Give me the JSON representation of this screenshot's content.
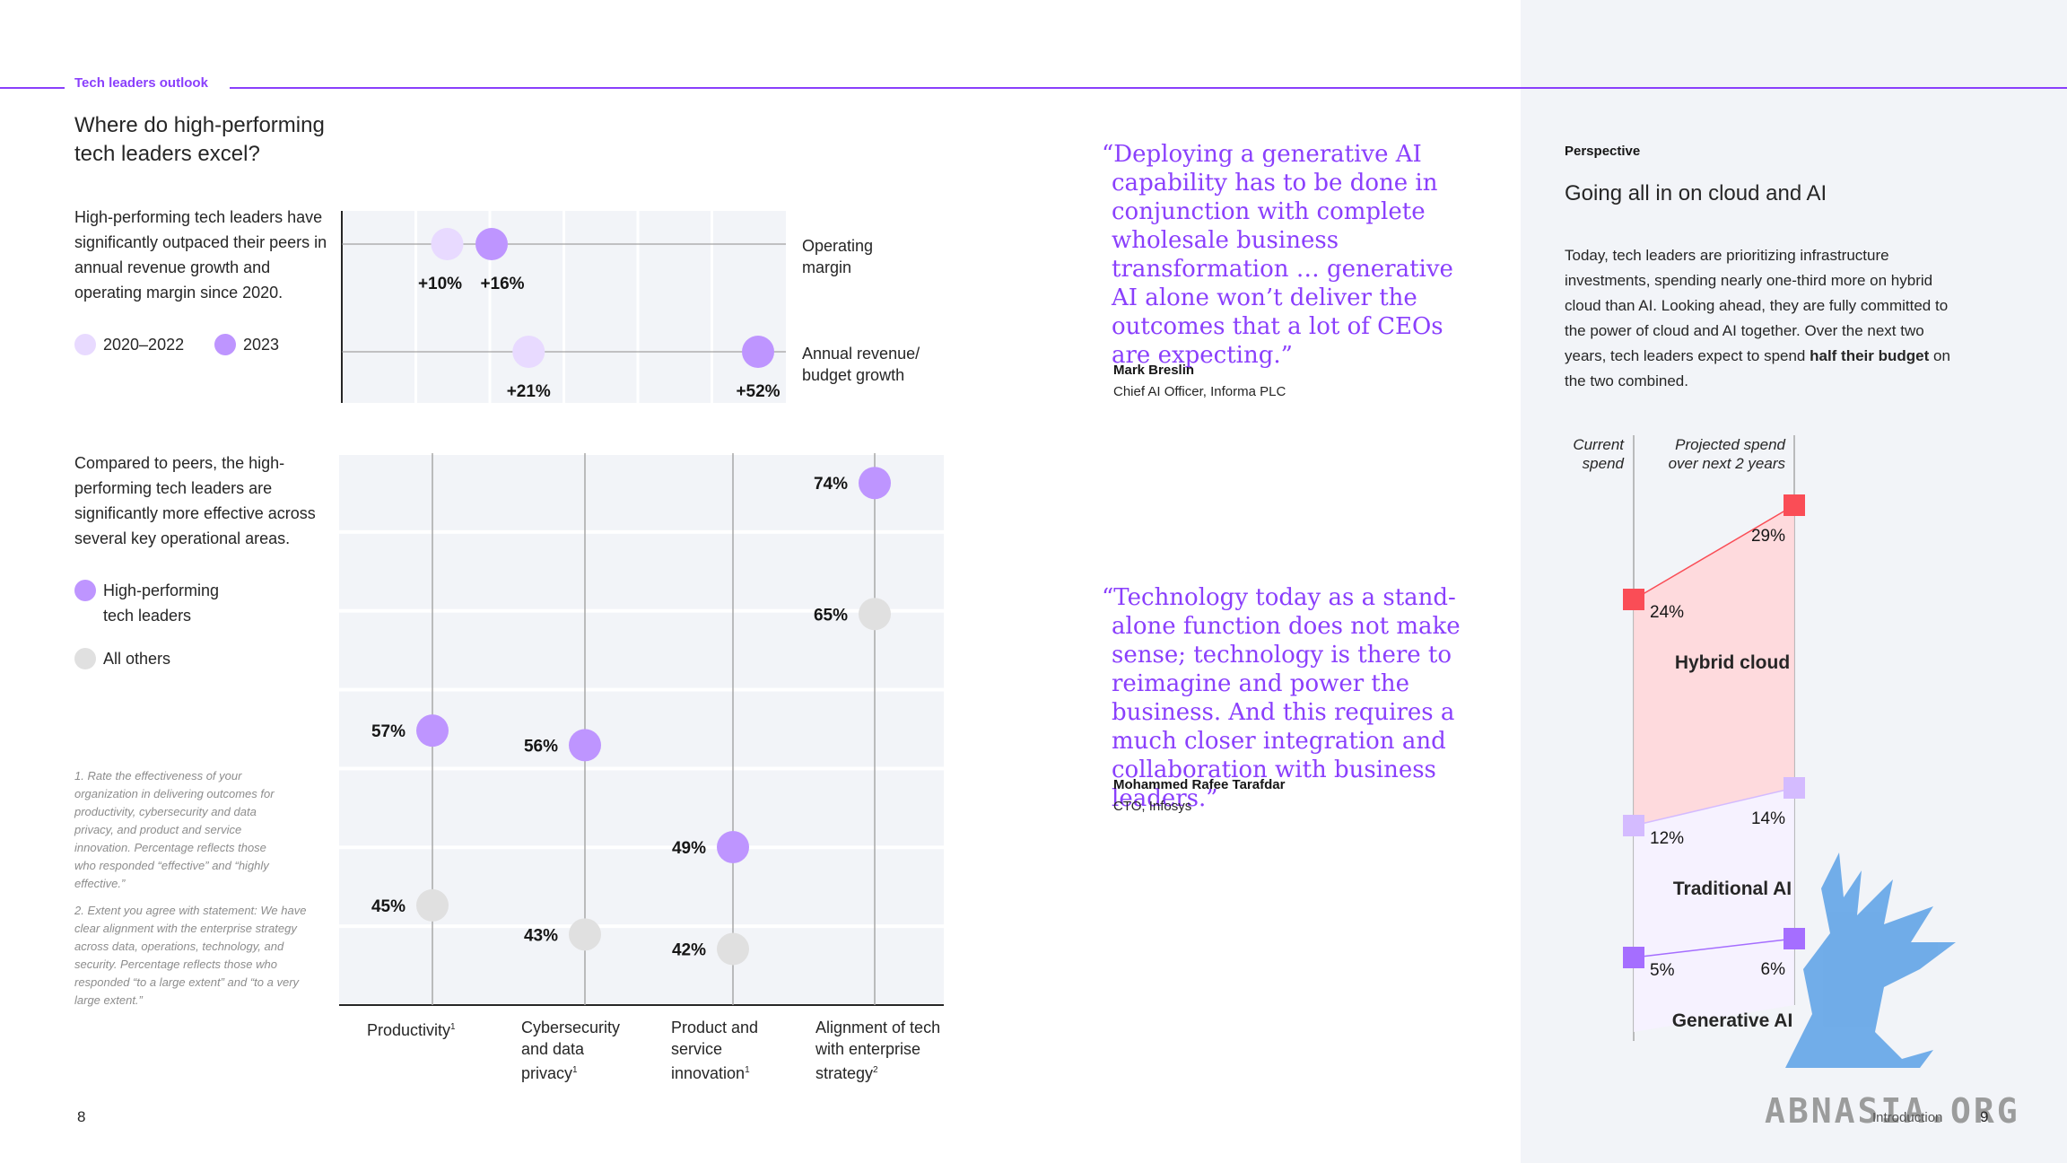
{
  "header": {
    "section_tag": "Tech leaders outlook"
  },
  "left_page": {
    "title": "Where do high-performing tech leaders excel?",
    "intro_text": "High-performing tech leaders have significantly outpaced their peers in annual revenue growth and operating margin since 2020.",
    "legend_top": [
      {
        "label": "2020–2022",
        "color": "#e8daff"
      },
      {
        "label": "2023",
        "color": "#be95ff"
      }
    ],
    "compare_text": "Compared to peers, the high-performing tech leaders are significantly more effective across several key operational areas.",
    "legend_bottom": [
      {
        "label": "High-performing tech leaders",
        "color": "#be95ff"
      },
      {
        "label": "All others",
        "color": "#e0e0e0"
      }
    ],
    "footnotes": [
      "1. Rate the effectiveness of your organization in delivering outcomes for productivity, cybersecurity and data privacy, and product and service innovation. Percentage reflects those who responded “effective” and “highly effective.”",
      "2. Extent you agree with statement: We have clear alignment with the enterprise strategy across data, operations, technology, and security. Percentage reflects those who responded “to a large extent” and “to a very large extent.”"
    ],
    "page_number": "8"
  },
  "chart_data": [
    {
      "type": "scatter",
      "title": "",
      "rows": [
        {
          "label": "Operating margin",
          "values": [
            {
              "period": "2020–2022",
              "value": 10,
              "text": "+10%"
            },
            {
              "period": "2023",
              "value": 16,
              "text": "+16%"
            }
          ]
        },
        {
          "label": "Annual revenue/ budget growth",
          "values": [
            {
              "period": "2020–2022",
              "value": 21,
              "text": "+21%"
            },
            {
              "period": "2023",
              "value": 52,
              "text": "+52%"
            }
          ]
        }
      ],
      "xlim": [
        0,
        60
      ],
      "grid": true
    },
    {
      "type": "scatter",
      "title": "",
      "categories": [
        "Productivity",
        "Cybersecurity and data privacy",
        "Product and service innovation",
        "Alignment of tech with enterprise strategy"
      ],
      "category_superscripts": [
        "1",
        "1",
        "1",
        "2"
      ],
      "series": [
        {
          "name": "High-performing tech leaders",
          "values": [
            57,
            56,
            49,
            74
          ],
          "color": "#be95ff"
        },
        {
          "name": "All others",
          "values": [
            45,
            43,
            42,
            65
          ],
          "color": "#e0e0e0"
        }
      ],
      "ylim": [
        40,
        75
      ],
      "grid": true
    },
    {
      "type": "line",
      "title": "",
      "x": [
        "Current spend",
        "Projected spend over next 2 years"
      ],
      "series": [
        {
          "name": "Hybrid cloud",
          "values": [
            24,
            29
          ],
          "color": "#fa4d56"
        },
        {
          "name": "Traditional AI",
          "values": [
            12,
            14
          ],
          "color": "#d4bbff"
        },
        {
          "name": "Generative AI",
          "values": [
            5,
            6
          ],
          "color": "#a56eff"
        }
      ]
    }
  ],
  "quotes": [
    {
      "text": "“Deploying a generative AI capability has to be done in conjunction with complete wholesale business transformation … generative AI alone won’t deliver the outcomes that a lot of CEOs are expecting.”",
      "name": "Mark Breslin",
      "role": "Chief AI Officer, Informa PLC"
    },
    {
      "text": "“Technology today as a stand-alone function does not make sense; technology is there to reimagine and power the business. And this requires a much closer integration and collaboration with business leaders.”",
      "name": "Mohammed Rafee Tarafdar",
      "role": "CTO, Infosys"
    }
  ],
  "perspective": {
    "label": "Perspective",
    "title": "Going all in on cloud and AI",
    "body_before": "Today, tech leaders are prioritizing infrastructure investments, spending nearly one-third more on hybrid cloud than AI. Looking ahead, they are fully committed to the power of cloud and AI together. Over the next two years, tech leaders expect to spend ",
    "body_bold": "half their budget",
    "body_after": " on the two combined.",
    "col_current": "Current spend",
    "col_projected": "Projected spend over next 2 years",
    "page_footer": "Introduction",
    "page_number": "9"
  },
  "watermark": {
    "text": "ABNASIA.ORG"
  },
  "colors": {
    "accent": "#8a3ffc",
    "hybrid_cloud": "#fa4d56",
    "traditional_ai": "#d4bbff",
    "generative_ai": "#a56eff",
    "grid_bg": "#f2f4f8"
  }
}
